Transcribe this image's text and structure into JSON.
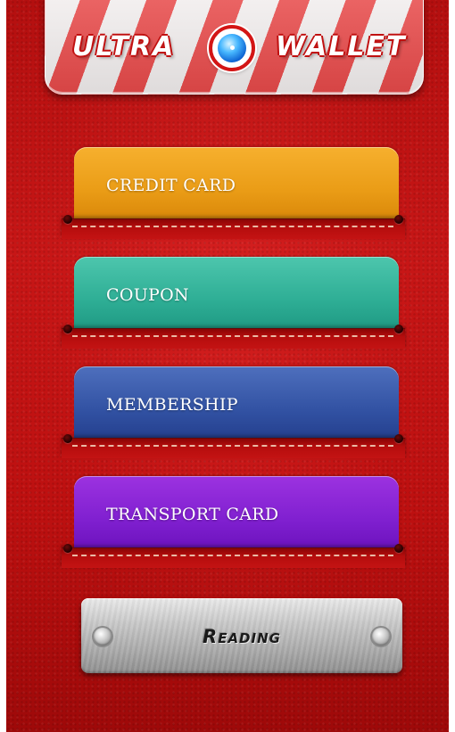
{
  "header": {
    "brand_left": "ULTRA",
    "brand_right": "WALLET",
    "logo_icon": "blue-orb-icon"
  },
  "cards": [
    {
      "label": "CREDIT CARD",
      "color": "#ea9c16"
    },
    {
      "label": "COUPON",
      "color": "#2eae95"
    },
    {
      "label": "MEMBERSHIP",
      "color": "#3252a3"
    },
    {
      "label": "TRANSPORT CARD",
      "color": "#8020d0"
    }
  ],
  "reading_button": {
    "label": "Reading"
  },
  "colors": {
    "background": "#c71616",
    "stitch": "#e9b9a5"
  }
}
